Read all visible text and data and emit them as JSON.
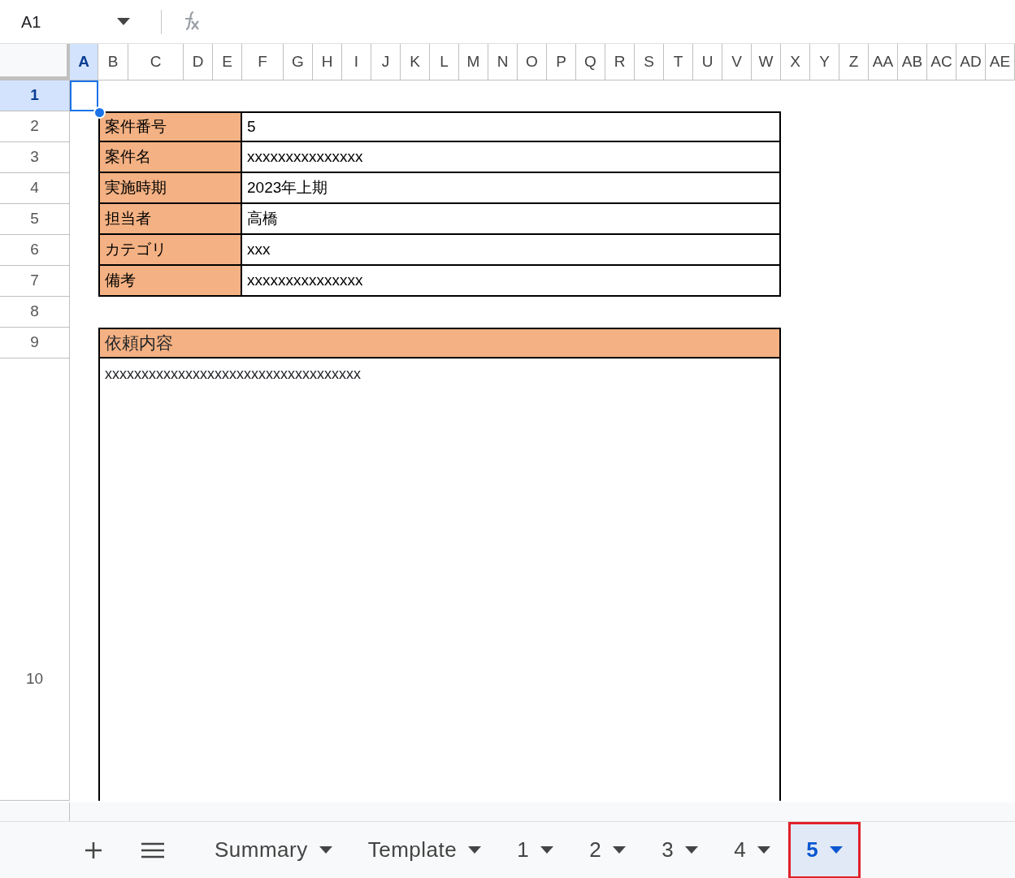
{
  "name_box": {
    "value": "A1"
  },
  "columns": [
    {
      "label": "A",
      "selected": true
    },
    {
      "label": "B",
      "selected": false
    },
    {
      "label": "C",
      "selected": false
    },
    {
      "label": "D",
      "selected": false
    },
    {
      "label": "E",
      "selected": false
    },
    {
      "label": "F",
      "selected": false
    },
    {
      "label": "G",
      "selected": false
    },
    {
      "label": "H",
      "selected": false
    },
    {
      "label": "I",
      "selected": false
    },
    {
      "label": "J",
      "selected": false
    },
    {
      "label": "K",
      "selected": false
    },
    {
      "label": "L",
      "selected": false
    },
    {
      "label": "M",
      "selected": false
    },
    {
      "label": "N",
      "selected": false
    },
    {
      "label": "O",
      "selected": false
    },
    {
      "label": "P",
      "selected": false
    },
    {
      "label": "Q",
      "selected": false
    },
    {
      "label": "R",
      "selected": false
    },
    {
      "label": "S",
      "selected": false
    },
    {
      "label": "T",
      "selected": false
    },
    {
      "label": "U",
      "selected": false
    },
    {
      "label": "V",
      "selected": false
    },
    {
      "label": "W",
      "selected": false
    },
    {
      "label": "X",
      "selected": false
    },
    {
      "label": "Y",
      "selected": false
    },
    {
      "label": "Z",
      "selected": false
    },
    {
      "label": "AA",
      "selected": false
    },
    {
      "label": "AB",
      "selected": false
    },
    {
      "label": "AC",
      "selected": false
    },
    {
      "label": "AD",
      "selected": false
    },
    {
      "label": "AE",
      "selected": false
    }
  ],
  "rows": [
    {
      "label": "1",
      "selected": true
    },
    {
      "label": "2",
      "selected": false
    },
    {
      "label": "3",
      "selected": false
    },
    {
      "label": "4",
      "selected": false
    },
    {
      "label": "5",
      "selected": false
    },
    {
      "label": "6",
      "selected": false
    },
    {
      "label": "7",
      "selected": false
    },
    {
      "label": "8",
      "selected": false
    },
    {
      "label": "9",
      "selected": false
    },
    {
      "label": "10",
      "selected": false
    }
  ],
  "info_table": [
    {
      "label": "案件番号",
      "value": "5"
    },
    {
      "label": "案件名",
      "value": "xxxxxxxxxxxxxxx"
    },
    {
      "label": "実施時期",
      "value": "2023年上期"
    },
    {
      "label": "担当者",
      "value": "高橋"
    },
    {
      "label": "カテゴリ",
      "value": "xxx"
    },
    {
      "label": "備考",
      "value": "xxxxxxxxxxxxxxx"
    }
  ],
  "request_section": {
    "heading": "依頼内容",
    "body": "xxxxxxxxxxxxxxxxxxxxxxxxxxxxxxxxxxx"
  },
  "sheet_tabs": [
    {
      "label": "Summary",
      "selected": false,
      "highlighted": false
    },
    {
      "label": "Template",
      "selected": false,
      "highlighted": false
    },
    {
      "label": "1",
      "selected": false,
      "highlighted": false
    },
    {
      "label": "2",
      "selected": false,
      "highlighted": false
    },
    {
      "label": "3",
      "selected": false,
      "highlighted": false
    },
    {
      "label": "4",
      "selected": false,
      "highlighted": false
    },
    {
      "label": "5",
      "selected": true,
      "highlighted": true
    }
  ]
}
